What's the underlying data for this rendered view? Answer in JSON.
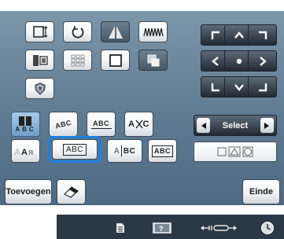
{
  "buttons": {
    "add_label": "Toevoegen",
    "end_label": "Einde"
  },
  "select": {
    "label": "Select"
  },
  "text_shapes": {
    "arc_up": "ABC",
    "straight": "ABC",
    "selected_flat": "ABC",
    "split": "BC",
    "boxed": "ABC",
    "spacing_a": "A",
    "spacing_c": "C"
  },
  "colors": {
    "panel": "#6b869d",
    "selected_outline": "#1e7fe0",
    "footer_bar": "#2b3845"
  },
  "icons": [
    "frame-size-icon",
    "rotate-icon",
    "mirror-icon",
    "density-icon",
    "color-change-icon",
    "array-icon",
    "frame-outline-icon",
    "copy-icon",
    "shield-icon",
    "text-array-icon",
    "eraser-icon",
    "page-icon",
    "trial-icon",
    "move-icon",
    "clock-icon"
  ]
}
